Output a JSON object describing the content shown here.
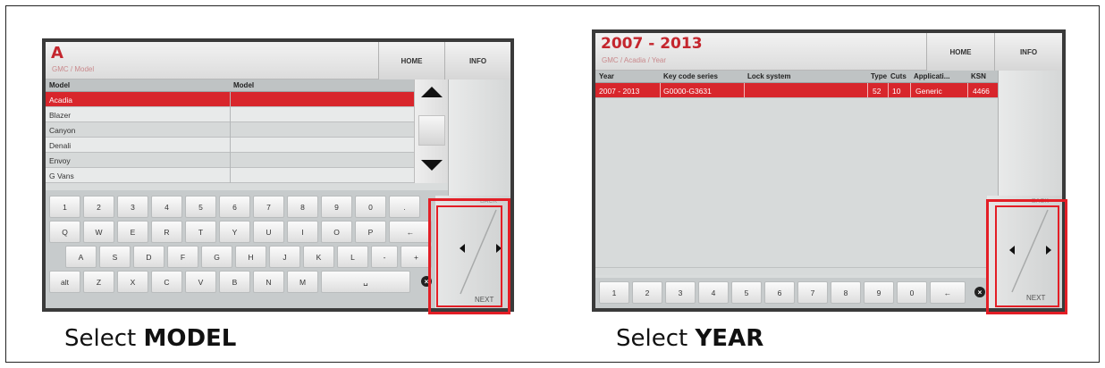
{
  "left_screen": {
    "header": {
      "title": "A",
      "subtitle": "GMC / Model",
      "home_label": "HOME",
      "info_label": "INFO"
    },
    "table": {
      "columns": [
        "Model",
        "Model"
      ],
      "rows": [
        "Acadia",
        "Blazer",
        "Canyon",
        "Denali",
        "Envoy",
        "G Vans"
      ],
      "selected_index": 0
    },
    "keyboard": {
      "row1": [
        "1",
        "2",
        "3",
        "4",
        "5",
        "6",
        "7",
        "8",
        "9",
        "0",
        "."
      ],
      "row2": [
        "Q",
        "W",
        "E",
        "R",
        "T",
        "Y",
        "U",
        "I",
        "O",
        "P",
        "←"
      ],
      "row3": [
        "A",
        "S",
        "D",
        "F",
        "G",
        "H",
        "J",
        "K",
        "L",
        "-",
        "+"
      ],
      "row4": [
        "alt",
        "Z",
        "X",
        "C",
        "V",
        "B",
        "N",
        "M",
        "␣"
      ]
    },
    "nav": {
      "back_label": "BACK",
      "next_label": "NEXT"
    }
  },
  "right_screen": {
    "header": {
      "title": "2007 - 2013",
      "subtitle": "GMC / Acadia / Year",
      "home_label": "HOME",
      "info_label": "INFO"
    },
    "table": {
      "columns": [
        "Year",
        "Key code series",
        "Lock system",
        "Type",
        "Cuts",
        "Applicati...",
        "KSN"
      ],
      "rows": [
        {
          "year": "2007 - 2013",
          "key_code_series": "G0000-G3631",
          "lock_system": "",
          "type": "52",
          "cuts": "10",
          "application": "Generic",
          "ksn": "4466"
        }
      ]
    },
    "numpad": [
      "1",
      "2",
      "3",
      "4",
      "5",
      "6",
      "7",
      "8",
      "9",
      "0",
      "←"
    ],
    "nav": {
      "back_label": "BACK",
      "next_label": "NEXT"
    }
  },
  "captions": {
    "left": {
      "prefix": "Select ",
      "bold": "MODEL"
    },
    "right": {
      "prefix": "Select ",
      "bold": "YEAR"
    }
  },
  "colors": {
    "accent": "#d8262c",
    "highlight_box": "#e31e26"
  }
}
